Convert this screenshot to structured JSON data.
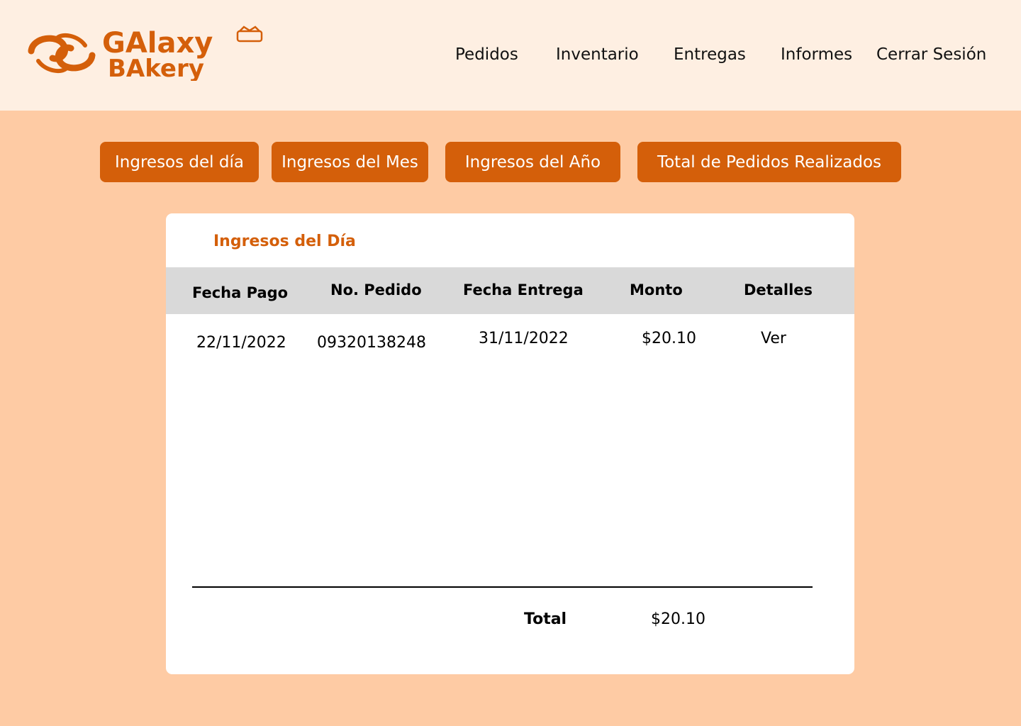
{
  "brand": {
    "name": "Galaxy Bakery",
    "logo_line1": "GAlaxy",
    "logo_line2": "BAkery",
    "color": "#D45F0A"
  },
  "nav": {
    "items": [
      {
        "label": "Pedidos"
      },
      {
        "label": "Inventario"
      },
      {
        "label": "Entregas"
      },
      {
        "label": "Informes"
      },
      {
        "label": "Cerrar Sesión"
      }
    ]
  },
  "tabs": [
    {
      "label": "Ingresos del día"
    },
    {
      "label": "Ingresos del Mes"
    },
    {
      "label": "Ingresos del Año"
    },
    {
      "label": "Total de Pedidos Realizados"
    }
  ],
  "report": {
    "title": "Ingresos del Día",
    "columns": [
      "Fecha Pago",
      "No. Pedido",
      "Fecha Entrega",
      "Monto",
      "Detalles"
    ],
    "rows": [
      {
        "fecha_pago": "22/11/2022",
        "no_pedido": "09320138248",
        "fecha_entrega": "31/11/2022",
        "monto": "$20.10",
        "detalles": "Ver"
      }
    ],
    "total_label": "Total",
    "total_value": "$20.10"
  },
  "colors": {
    "accent": "#D45F0A",
    "header_bg": "#FEEFE2",
    "page_bg": "#FECBA4",
    "table_header_bg": "#D9D9D9"
  }
}
